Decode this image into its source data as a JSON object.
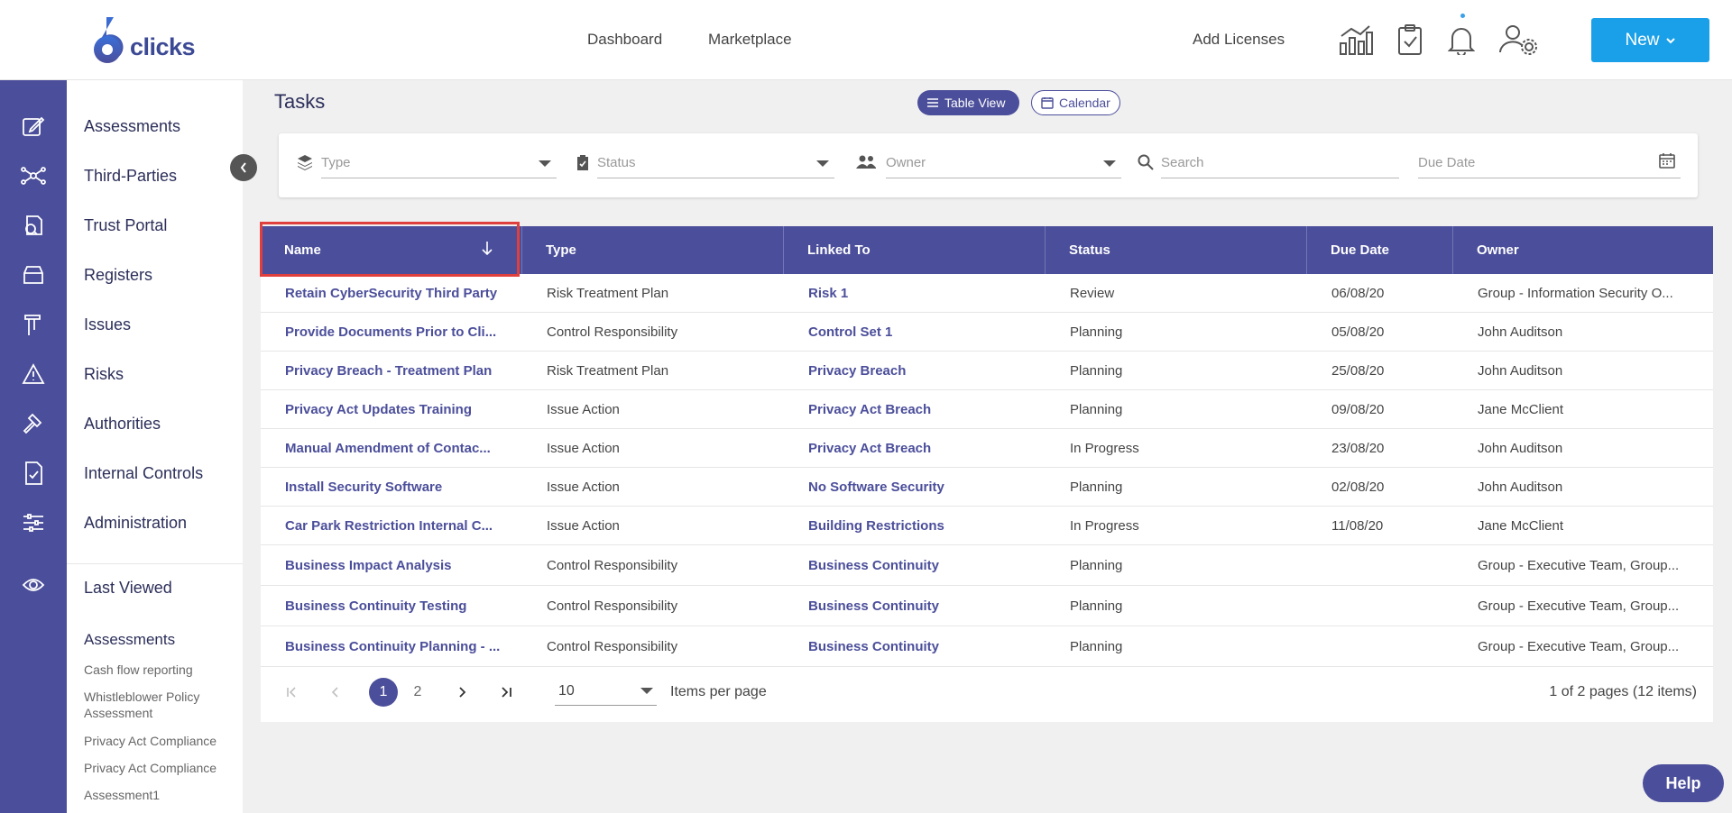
{
  "brand": {
    "logo_text": "clicks",
    "logo_mark": "6"
  },
  "header": {
    "nav": [
      "Dashboard",
      "Marketplace"
    ],
    "add_licenses": "Add Licenses",
    "new_button": "New"
  },
  "colors": {
    "primary": "#4b4e9a",
    "accent": "#1aa0e8",
    "highlight": "#e0403d"
  },
  "rail_icons": [
    "edit-icon",
    "network-icon",
    "portal-icon",
    "register-icon",
    "issue-icon",
    "risk-icon",
    "gavel-icon",
    "controls-icon",
    "admin-icon",
    "eye-icon"
  ],
  "sidebar": {
    "items": [
      "Assessments",
      "Third-Parties",
      "Trust Portal",
      "Registers",
      "Issues",
      "Risks",
      "Authorities",
      "Internal Controls",
      "Administration"
    ],
    "last_viewed_title": "Last Viewed",
    "recent_section": "Assessments",
    "recent": [
      "Cash flow reporting",
      "Whistleblower Policy Assessment",
      "Privacy Act Compliance",
      "Privacy Act Compliance",
      "Assessment1"
    ]
  },
  "page": {
    "title": "Tasks",
    "views": {
      "table": "Table View",
      "calendar": "Calendar"
    }
  },
  "filters": {
    "type": "Type",
    "status": "Status",
    "owner": "Owner",
    "search": "Search",
    "due_date": "Due Date"
  },
  "table": {
    "columns": [
      "Name",
      "Type",
      "Linked To",
      "Status",
      "Due Date",
      "Owner"
    ],
    "sort": {
      "column": "Name",
      "direction": "descending"
    },
    "rows": [
      [
        "Retain CyberSecurity Third Party",
        "Risk Treatment Plan",
        "Risk 1",
        "Review",
        "06/08/20",
        "Group - Information Security O..."
      ],
      [
        "Provide Documents Prior to Cli...",
        "Control Responsibility",
        "Control Set 1",
        "Planning",
        "05/08/20",
        "John Auditson"
      ],
      [
        "Privacy Breach - Treatment Plan",
        "Risk Treatment Plan",
        "Privacy Breach",
        "Planning",
        "25/08/20",
        "John Auditson"
      ],
      [
        "Privacy Act Updates Training",
        "Issue Action",
        "Privacy Act Breach",
        "Planning",
        "09/08/20",
        "Jane McClient"
      ],
      [
        "Manual Amendment of Contac...",
        "Issue Action",
        "Privacy Act Breach",
        "In Progress",
        "23/08/20",
        "John Auditson"
      ],
      [
        "Install Security Software",
        "Issue Action",
        "No Software Security",
        "Planning",
        "02/08/20",
        "John Auditson"
      ],
      [
        "Car Park Restriction Internal C...",
        "Issue Action",
        "Building Restrictions",
        "In Progress",
        "11/08/20",
        "Jane McClient"
      ],
      [
        "Business Impact Analysis",
        "Control Responsibility",
        "Business Continuity",
        "Planning",
        "",
        "Group - Executive Team, Group..."
      ],
      [
        "Business Continuity Testing",
        "Control Responsibility",
        "Business Continuity",
        "Planning",
        "",
        "Group - Executive Team, Group..."
      ],
      [
        "Business Continuity Planning - ...",
        "Control Responsibility",
        "Business Continuity",
        "Planning",
        "",
        "Group - Executive Team, Group..."
      ]
    ]
  },
  "pager": {
    "pages": [
      "1",
      "2"
    ],
    "current": "1",
    "items_per_page": "10",
    "items_per_page_label": "Items per page",
    "info": "1 of 2 pages (12 items)"
  },
  "help": "Help"
}
